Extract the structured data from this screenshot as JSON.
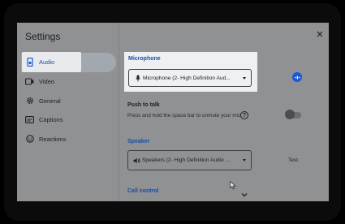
{
  "dialog": {
    "title": "Settings"
  },
  "nav": {
    "items": [
      {
        "label": "Audio",
        "icon": "speaker-device-icon",
        "active": true
      },
      {
        "label": "Video",
        "icon": "video-camera-icon",
        "active": false
      },
      {
        "label": "General",
        "icon": "gear-icon",
        "active": false
      },
      {
        "label": "Captions",
        "icon": "captions-icon",
        "active": false
      },
      {
        "label": "Reactions",
        "icon": "smiley-icon",
        "active": false
      }
    ]
  },
  "audio": {
    "microphone": {
      "label": "Microphone",
      "selected": "Microphone (2- High Definition Aud..."
    },
    "push_to_talk": {
      "label": "Push to talk",
      "description": "Press and hold the space bar to unmute your mic",
      "enabled": false
    },
    "speaker": {
      "label": "Speaker",
      "selected": "Speakers (2- High Definition Audio ...",
      "test_label": "Test"
    },
    "call_control": {
      "label": "Call control"
    }
  },
  "colors": {
    "accent": "#1a56d6",
    "section_label": "#174ea6",
    "highlight": "#eef0f3",
    "overlay": "#8f9193"
  }
}
